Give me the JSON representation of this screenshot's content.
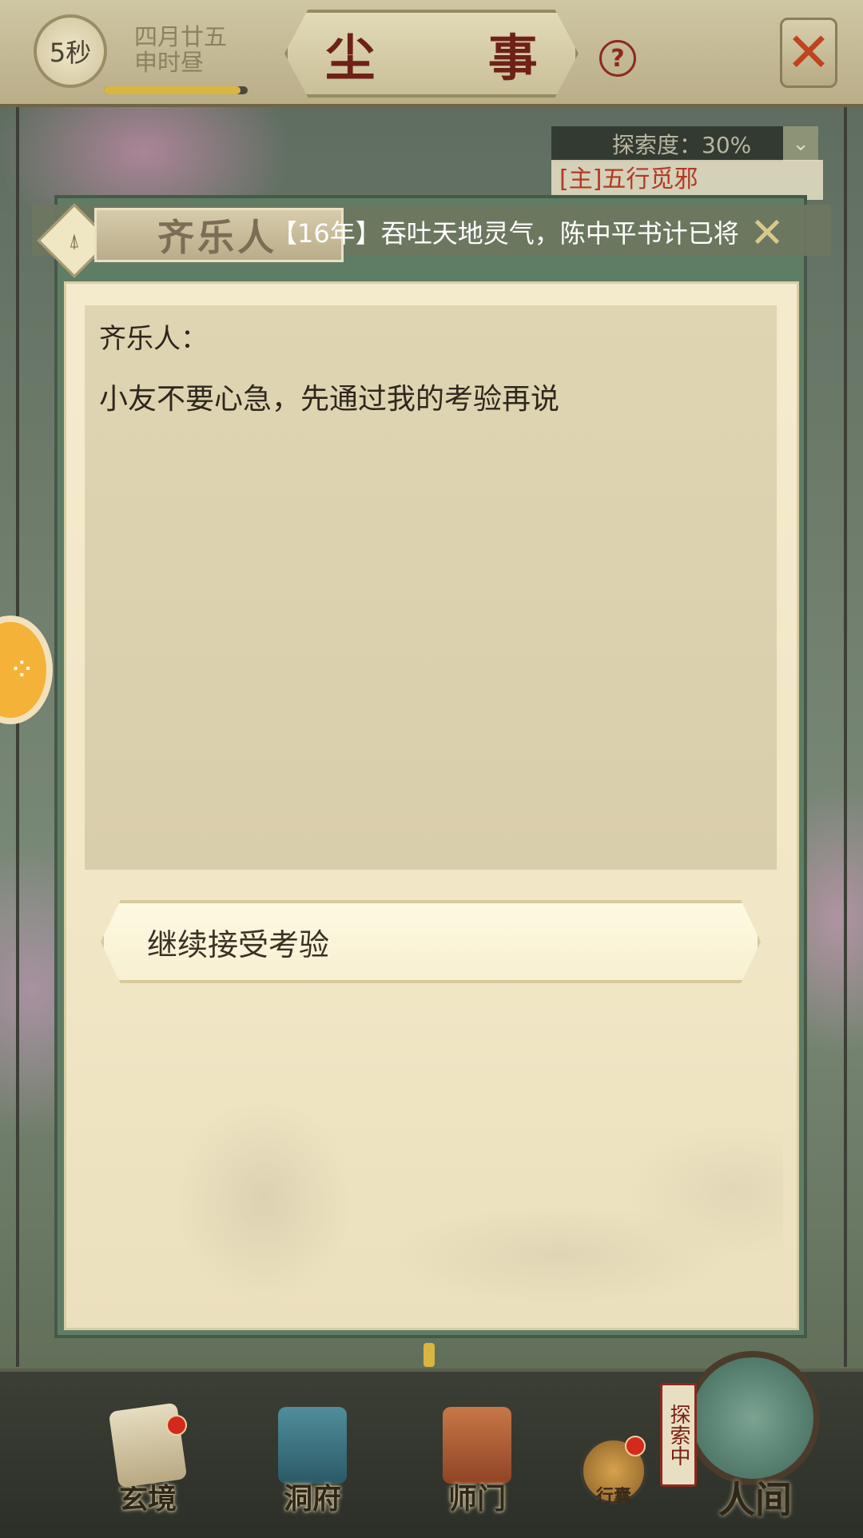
{
  "top_bar": {
    "timer_label": "5秒",
    "timer_progress": 0.95,
    "date_line1": "四月廿五",
    "date_line2": "申时昼",
    "title": "尘 事",
    "help_label": "?",
    "close_glyph": "✕"
  },
  "explore": {
    "progress_text": "探索度：30%",
    "chevron_glyph": "⌄",
    "quest_text": "[主]五行觅邪"
  },
  "dialog": {
    "speaker_name": "齐乐人",
    "ticker_text": "【16年】吞吐天地灵气，陈中平书计已将",
    "ticker_close": "✕",
    "speaker_line": "齐乐人：",
    "dialogue_text": "小友不要心急，先通过我的考验再说",
    "choices": [
      {
        "label": "继续接受考验"
      }
    ]
  },
  "side_button": {
    "glyph": "⁘"
  },
  "bottom_nav": {
    "items": [
      {
        "label": "玄境",
        "has_badge": true
      },
      {
        "label": "洞府",
        "has_badge": false
      },
      {
        "label": "师门",
        "has_badge": false
      }
    ],
    "bag_label": "行囊",
    "explore_badge": "探索中",
    "world_label": "人间"
  },
  "colors": {
    "title_red": "#6e2118",
    "panel_green": "#5f7d64",
    "parchment": "#f4ebcd",
    "badge_red": "#d42a1d"
  }
}
